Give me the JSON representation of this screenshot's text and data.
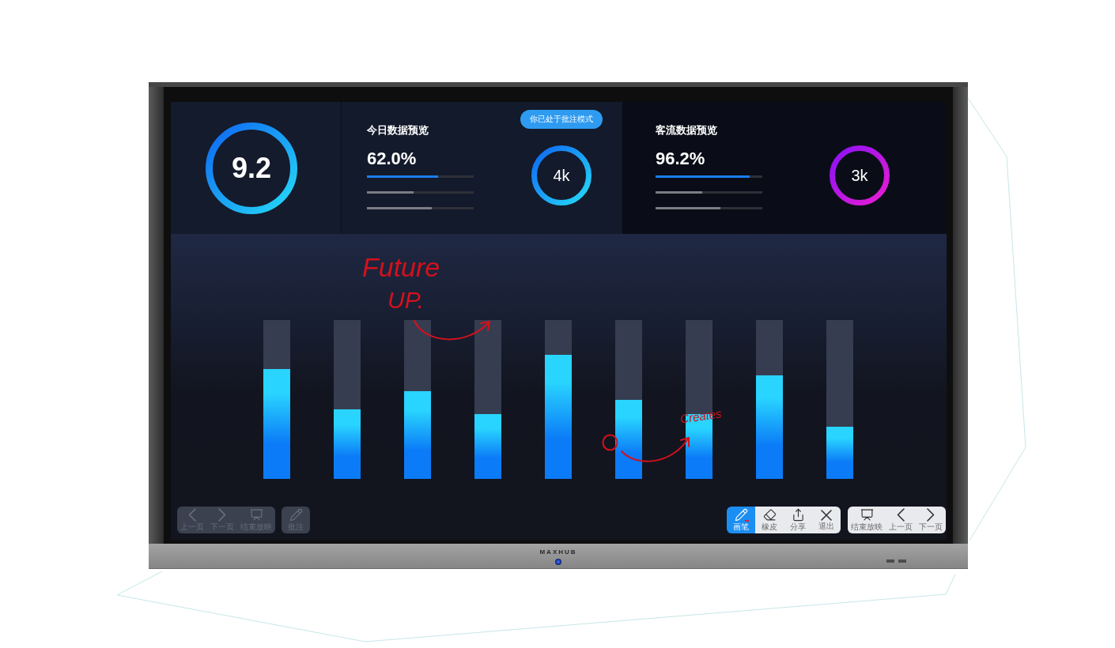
{
  "score": {
    "value": "9.2"
  },
  "notice": "你已处于批注模式",
  "panels": [
    {
      "title": "今日数据预览",
      "percent": "62.0%",
      "bars": [
        {
          "level": 0.67
        },
        {
          "level": 0.44
        },
        {
          "level": 0.61
        }
      ],
      "ring_value": "4k"
    },
    {
      "title": "客流数据预览",
      "percent": "96.2%",
      "bars": [
        {
          "level": 0.88
        },
        {
          "level": 0.44
        },
        {
          "level": 0.61
        }
      ],
      "ring_value": "3k"
    }
  ],
  "chart_bars": [
    {
      "level": 0.69
    },
    {
      "level": 0.44
    },
    {
      "level": 0.55
    },
    {
      "level": 0.41
    },
    {
      "level": 0.78
    },
    {
      "level": 0.5
    },
    {
      "level": 0.41
    },
    {
      "level": 0.65
    },
    {
      "level": 0.33
    }
  ],
  "ink_notes": [
    {
      "text": "Future"
    },
    {
      "text": "UP."
    },
    {
      "text": "Creates"
    }
  ],
  "playback_controls": [
    {
      "kind": "prev",
      "label": "上一页",
      "disabled": true
    },
    {
      "kind": "next",
      "label": "下一页",
      "disabled": true
    },
    {
      "kind": "end-show",
      "label": "结束放映",
      "disabled": true
    }
  ],
  "annotate_button": {
    "kind": "pen",
    "label": "批注",
    "disabled": true
  },
  "annotation_tools": [
    {
      "kind": "pen",
      "label": "画笔",
      "selected": true
    },
    {
      "kind": "eraser",
      "label": "橡皮",
      "selected": false
    },
    {
      "kind": "share",
      "label": "分享",
      "selected": false
    },
    {
      "kind": "exit",
      "label": "退出",
      "selected": false
    }
  ],
  "slide_controls": [
    {
      "kind": "end-show",
      "label": "结束放映"
    },
    {
      "kind": "prev",
      "label": "上一页"
    },
    {
      "kind": "next",
      "label": "下一页"
    }
  ],
  "device": {
    "brand": "MAXHUB"
  }
}
